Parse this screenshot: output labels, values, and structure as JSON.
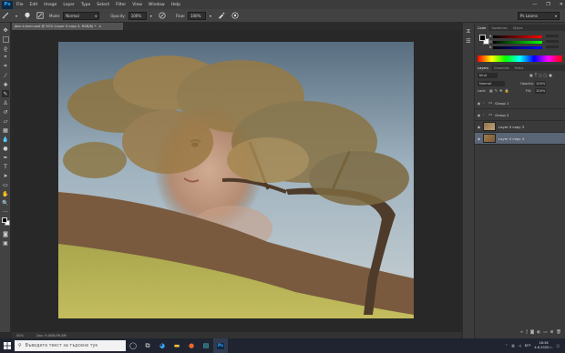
{
  "app": {
    "logo": "Ps"
  },
  "menu": [
    "File",
    "Edit",
    "Image",
    "Layer",
    "Type",
    "Select",
    "Filter",
    "View",
    "Window",
    "Help"
  ],
  "window_controls": {
    "minimize": "—",
    "maximize": "❐",
    "close": "✕"
  },
  "options": {
    "mode_label": "Mode:",
    "mode_value": "Normal",
    "opacity_label": "Opacity:",
    "opacity_value": "100%",
    "flow_label": "Flow:",
    "flow_value": "100%",
    "workspace": "Ps Learns"
  },
  "document": {
    "tab_title": "jbec-t-karrn.psd @ 50% (Layer 0 copy 4, RGB/8) *",
    "close": "×",
    "zoom": "50%",
    "doc_info": "Doc: 9,00M/39,8M"
  },
  "panels": {
    "color_tabs": [
      "Color",
      "Swatches",
      "Styles"
    ],
    "color": {
      "r": "R",
      "g": "G",
      "b": "B"
    },
    "layers_tabs": [
      "Layers",
      "Channels",
      "Paths"
    ],
    "kind": "Kind",
    "blend_mode": "Normal",
    "opacity_label": "Opacity:",
    "opacity_value": "100%",
    "lock_label": "Lock:",
    "fill_label": "Fill:",
    "fill_value": "100%",
    "layers": [
      {
        "name": "Group 1",
        "type": "group"
      },
      {
        "name": "Group 2",
        "type": "group"
      },
      {
        "name": "Layer 0 copy 3",
        "type": "layer"
      },
      {
        "name": "Layer 0 copy 4",
        "type": "layer",
        "selected": true
      }
    ]
  },
  "taskbar": {
    "search_placeholder": "Въведете текст за търсене тук",
    "language": "БГР",
    "time": "18:36",
    "date": "4.6.2020 г."
  }
}
